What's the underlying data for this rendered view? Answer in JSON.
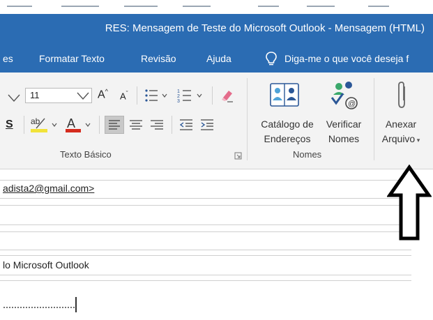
{
  "window": {
    "title": "RES: Mensagem de Teste do Microsoft Outlook  -  Mensagem (HTML)"
  },
  "menu": {
    "items": [
      {
        "label": "es"
      },
      {
        "label": "Formatar Texto"
      },
      {
        "label": "Revisão"
      },
      {
        "label": "Ajuda"
      }
    ],
    "tell_me": "Diga-me o que você deseja f"
  },
  "ribbon": {
    "font_size": "11",
    "grow_font": "A",
    "shrink_font": "A",
    "underline_glyph": "S",
    "highlight_glyph": "ab",
    "font_color_glyph": "A",
    "groups": {
      "basic_text_label": "Texto Básico",
      "names_label": "Nomes"
    },
    "address_book": {
      "line1": "Catálogo de",
      "line2": "Endereços"
    },
    "check_names": {
      "line1": "Verificar",
      "line2": "Nomes"
    },
    "attach_file": {
      "line1": "Anexar",
      "line2": "Arquivo"
    },
    "colors": {
      "title_bar": "#2b6cb3",
      "highlight": "#f1e33a",
      "font_color": "#d52b1e",
      "annotation": "#000000"
    }
  },
  "message": {
    "to": "adista2@gmail.com>",
    "subject": "lo Microsoft Outlook"
  }
}
